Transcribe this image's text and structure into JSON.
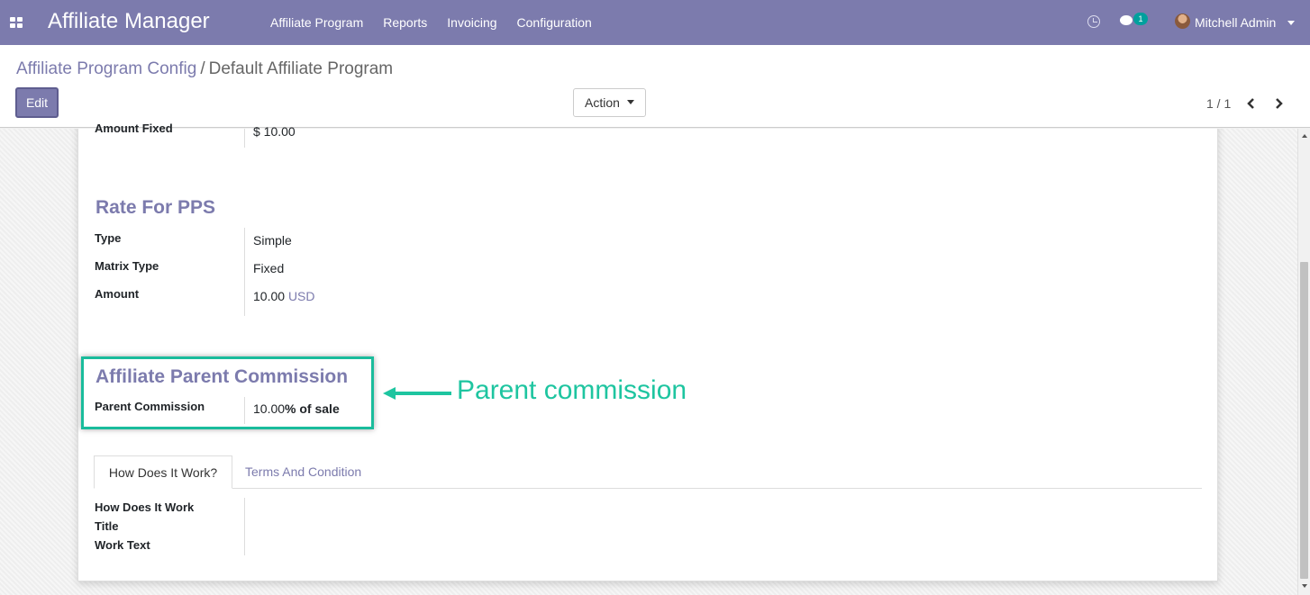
{
  "navbar": {
    "brand": "Affiliate Manager",
    "menu": [
      "Affiliate Program",
      "Reports",
      "Invoicing",
      "Configuration"
    ],
    "chat_badge": "1",
    "user_name": "Mitchell Admin"
  },
  "control_panel": {
    "breadcrumb_parent": "Affiliate Program Config",
    "breadcrumb_sep": "/",
    "breadcrumb_current": "Default Affiliate Program",
    "edit_label": "Edit",
    "action_label": "Action",
    "pager": "1 / 1",
    "prev_glyph": "‹",
    "next_glyph": "›"
  },
  "form": {
    "amount_fixed": {
      "label": "Amount Fixed",
      "value": "$ 10.00"
    },
    "pps_section": {
      "title": "Rate For PPS",
      "type": {
        "label": "Type",
        "value": "Simple"
      },
      "matrix_type": {
        "label": "Matrix Type",
        "value": "Fixed"
      },
      "amount": {
        "label": "Amount",
        "value": "10.00",
        "currency": "USD"
      }
    },
    "parent_section": {
      "title": "Affiliate Parent Commission",
      "parent_commission": {
        "label": "Parent Commission",
        "value": "10.00",
        "suffix": "% of sale"
      }
    },
    "annotation": "Parent commission",
    "tabs": [
      "How Does It Work?",
      "Terms And Condition"
    ],
    "how_it_works": {
      "title_label_line1": "How Does It Work",
      "title_label_line2": "Title",
      "work_text_label": "Work Text"
    }
  },
  "colors": {
    "navbar": "#7c7bad",
    "accent": "#7c7bad",
    "annotation": "#1ec5a0"
  }
}
